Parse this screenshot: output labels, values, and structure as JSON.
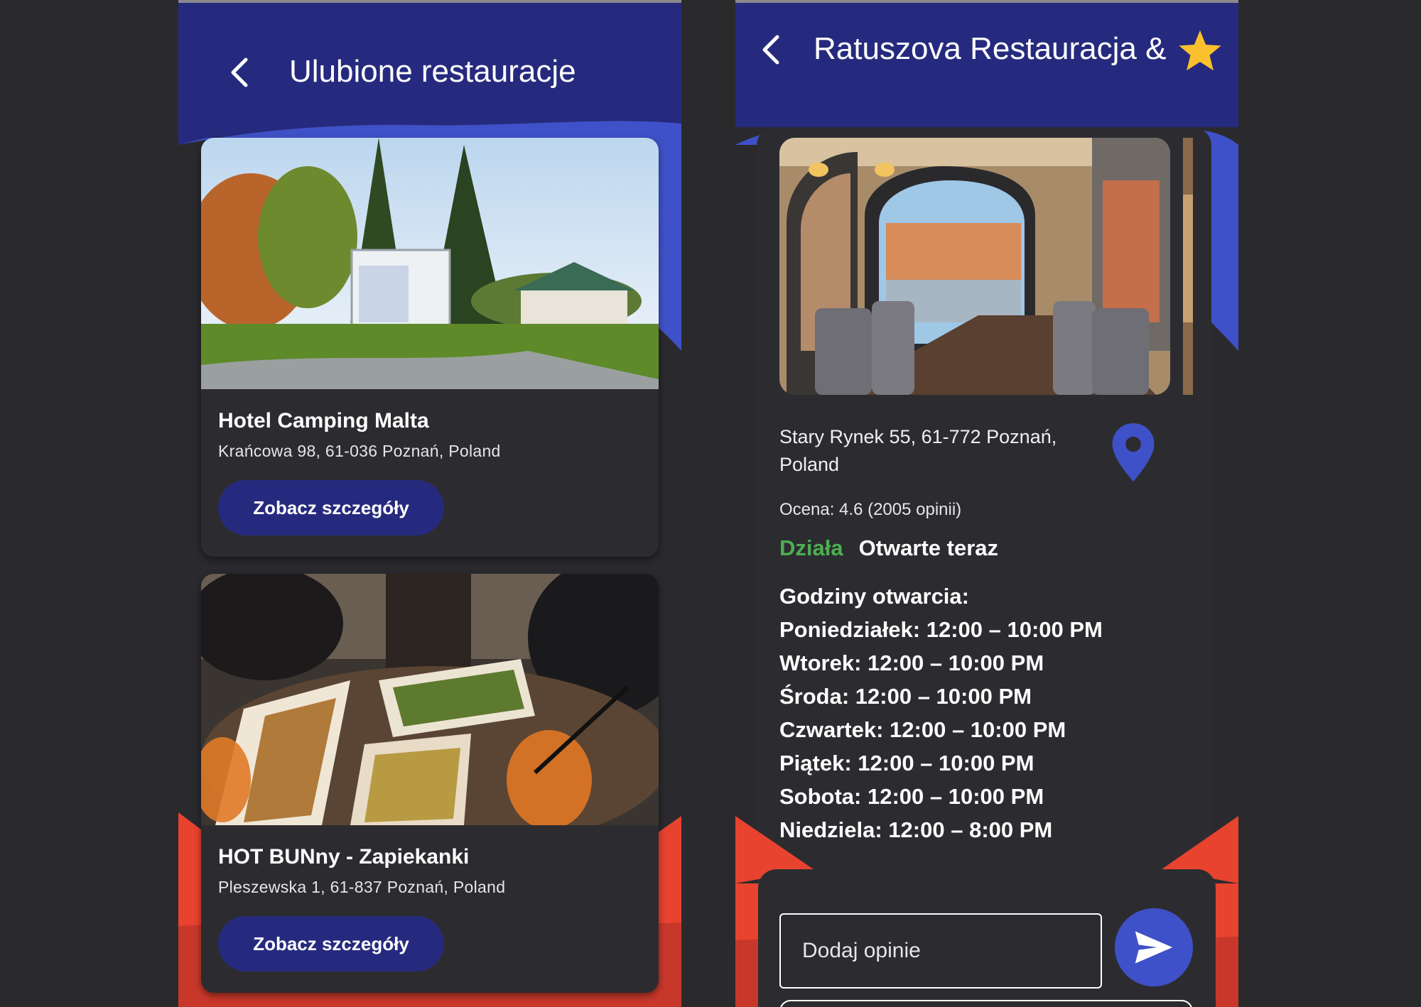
{
  "favorites_screen": {
    "title": "Ulubione restauracje",
    "cards": [
      {
        "name": "Hotel Camping Malta",
        "address": "Krańcowa 98, 61-036 Poznań, Poland",
        "button_label": "Zobacz szczegóły"
      },
      {
        "name": "HOT BUNny - Zapiekanki",
        "address": "Pleszewska 1, 61-837 Poznań, Poland",
        "button_label": "Zobacz szczegóły"
      }
    ]
  },
  "details_screen": {
    "title": "Ratuszova Restauracja &",
    "favorite_icon": "star-icon",
    "address": "Stary Rynek 55, 61-772 Poznań, Poland",
    "rating": "Ocena: 4.6 (2005 opinii)",
    "status": "Działa",
    "open_now": "Otwarte teraz",
    "hours_title": "Godziny otwarcia:",
    "hours": [
      "Poniedziałek: 12:00 – 10:00 PM",
      "Wtorek: 12:00 – 10:00 PM",
      "Środa: 12:00 – 10:00 PM",
      "Czwartek: 12:00 – 10:00 PM",
      "Piątek: 12:00 – 10:00 PM",
      "Sobota: 12:00 – 10:00 PM",
      "Niedziela: 12:00 – 8:00 PM"
    ],
    "review_placeholder": "Dodaj opinie"
  },
  "colors": {
    "header_blue": "#262a7e",
    "accent_blue": "#3f51c8",
    "accent_red": "#e8432f",
    "open_green": "#4caf50",
    "star_yellow": "#fbc02d"
  }
}
